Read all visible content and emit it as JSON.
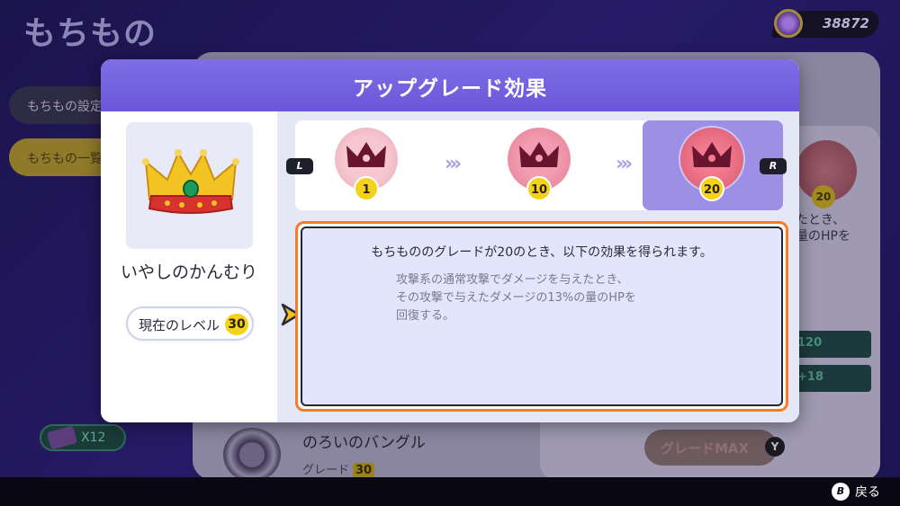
{
  "background": {
    "title": "もちもの",
    "currency_amount": "38872",
    "menu": {
      "settings_label": "もちもの設定",
      "list_label": "もちもの一覧"
    },
    "ticket_count": "X12",
    "side_card": {
      "text_line1": "たとき、",
      "text_line2": "量のHPを",
      "badge_level": "20",
      "stat1": "120",
      "stat2": "+18"
    },
    "grade_button_label": "グレードMAX",
    "grade_button_key": "Y",
    "list_item": {
      "name": "のろいのバングル",
      "grade_label": "グレード",
      "grade_value": "30"
    }
  },
  "modal": {
    "title": "アップグレード効果",
    "item_name": "いやしのかんむり",
    "current_level_label": "現在のレベル",
    "current_level_value": "30",
    "nav_left": "L",
    "nav_right": "R",
    "grades": [
      "1",
      "10",
      "20"
    ],
    "selected_grade_index": 2,
    "effect_summary": "もちもののグレードが20のとき、以下の効果を得られます。",
    "effect_detail_lines": [
      "攻撃系の通常攻撃でダメージを与えたとき、",
      "その攻撃で与えたダメージの13%の量のHPを",
      "回復する。"
    ]
  },
  "footer": {
    "back_key": "B",
    "back_label": "戻る"
  },
  "colors": {
    "header": "#7563e0",
    "highlight": "#ff7a1e",
    "selected_grade": "#9d8fe6",
    "level_badge": "#f4d21a"
  }
}
